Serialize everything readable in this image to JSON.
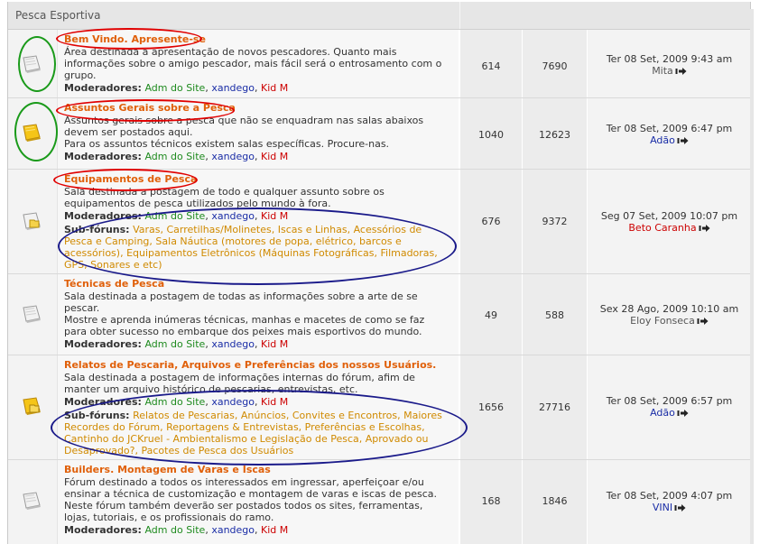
{
  "category": {
    "title": "Pesca Esportiva"
  },
  "labels": {
    "moderators": "Moderadores:",
    "subforums": "Sub-fóruns:"
  },
  "moderators": [
    "Adm do Site",
    "xandego",
    "Kid M"
  ],
  "colors": {
    "forum_title": "#e0600a",
    "mod_green": "#1e8a1e",
    "mod_blue": "#1a2da6",
    "mod_red": "#cc0000",
    "subforum_link": "#d08a00",
    "annotation_red": "#e00000",
    "annotation_green": "#1a9a1a",
    "annotation_navy": "#1a1a8a"
  },
  "forums": [
    {
      "name": "Bem Vindo. Apresente-se",
      "description": [
        "Área destinada a apresentação de novos pescadores. Quanto mais",
        "informações sobre o amigo pescador, mais fácil será o entrosamento com o",
        "grupo."
      ],
      "icon": "folder-read-icon",
      "topics": "614",
      "posts": "7690",
      "last_post": {
        "date": "Ter 08 Set, 2009 9:43 am",
        "user": "Mita"
      }
    },
    {
      "name": "Assuntos Gerais sobre a Pesca",
      "description": [
        "Assuntos gerais sobre a pesca que não se enquadram nas salas abaixos",
        "devem ser postados aqui.",
        "Para os assuntos técnicos existem salas específicas. Procure-nas."
      ],
      "icon": "folder-new-icon",
      "topics": "1040",
      "posts": "12623",
      "last_post": {
        "date": "Ter 08 Set, 2009 6:47 pm",
        "user": "Adão"
      }
    },
    {
      "name": "Equipamentos de Pesca",
      "description": [
        "Sala destinada a postagem de todo e qualquer assunto sobre os",
        "equipamentos de pesca utilizados pelo mundo à fora."
      ],
      "icon": "folder-subforum-icon",
      "subforums_lines": [
        [
          "Varas, Carretilhas/Molinetes, Iscas e Linhas, Acessórios de"
        ],
        [
          "Pesca e Camping, Sala Náutica (motores de popa, elétrico, barcos e"
        ],
        [
          "acessórios), Equipamentos Eletrônicos (Máquinas Fotográficas, Filmadoras,"
        ],
        [
          "GPS, Sonares e etc)"
        ]
      ],
      "topics": "676",
      "posts": "9372",
      "last_post": {
        "date": "Seg 07 Set, 2009 10:07 pm",
        "user": "Beto Caranha"
      }
    },
    {
      "name": "Técnicas de Pesca",
      "description": [
        "Sala destinada a postagem de todas as informações sobre a arte de se",
        "pescar.",
        "Mostre e aprenda inúmeras técnicas, manhas e macetes de como se faz",
        "para obter sucesso no embarque dos peixes mais esportivos do mundo."
      ],
      "icon": "folder-read-icon",
      "topics": "49",
      "posts": "588",
      "last_post": {
        "date": "Sex 28 Ago, 2009 10:10 am",
        "user": "Eloy Fonseca"
      }
    },
    {
      "name": "Relatos de Pescaria, Arquivos e Preferências dos nossos Usuários.",
      "description": [
        "Sala destinada a postagem de informações internas do fórum, afim de",
        "manter um arquivo histórico de pescarias, entrevistas, etc."
      ],
      "icon": "folder-new-subforum-icon",
      "subforums_lines": [
        [
          "Relatos de Pescarias, Anúncios, Convites e Encontros, Maiores"
        ],
        [
          "Recordes do Fórum, Reportagens & Entrevistas, Preferências e Escolhas,"
        ],
        [
          "Cantinho do JCKruel - Ambientalismo e Legislação de Pesca, Aprovado ou"
        ],
        [
          "Desaprovado?, Pacotes de Pesca dos Usuários"
        ]
      ],
      "topics": "1656",
      "posts": "27716",
      "last_post": {
        "date": "Ter 08 Set, 2009 6:57 pm",
        "user": "Adão"
      }
    },
    {
      "name": "Builders. Montagem de Varas e Iscas",
      "description": [
        "Fórum destinado a todos os interessados em ingressar, aperfeiçoar e/ou",
        "ensinar a técnica de customização e montagem de varas e iscas de pesca.",
        "Neste fórum também deverão ser postados todos os sites, ferramentas,",
        "lojas, tutoriais, e os profissionais do ramo."
      ],
      "icon": "folder-read-icon",
      "topics": "168",
      "posts": "1846",
      "last_post": {
        "date": "Ter 08 Set, 2009 4:07 pm",
        "user": "VINI"
      }
    }
  ]
}
